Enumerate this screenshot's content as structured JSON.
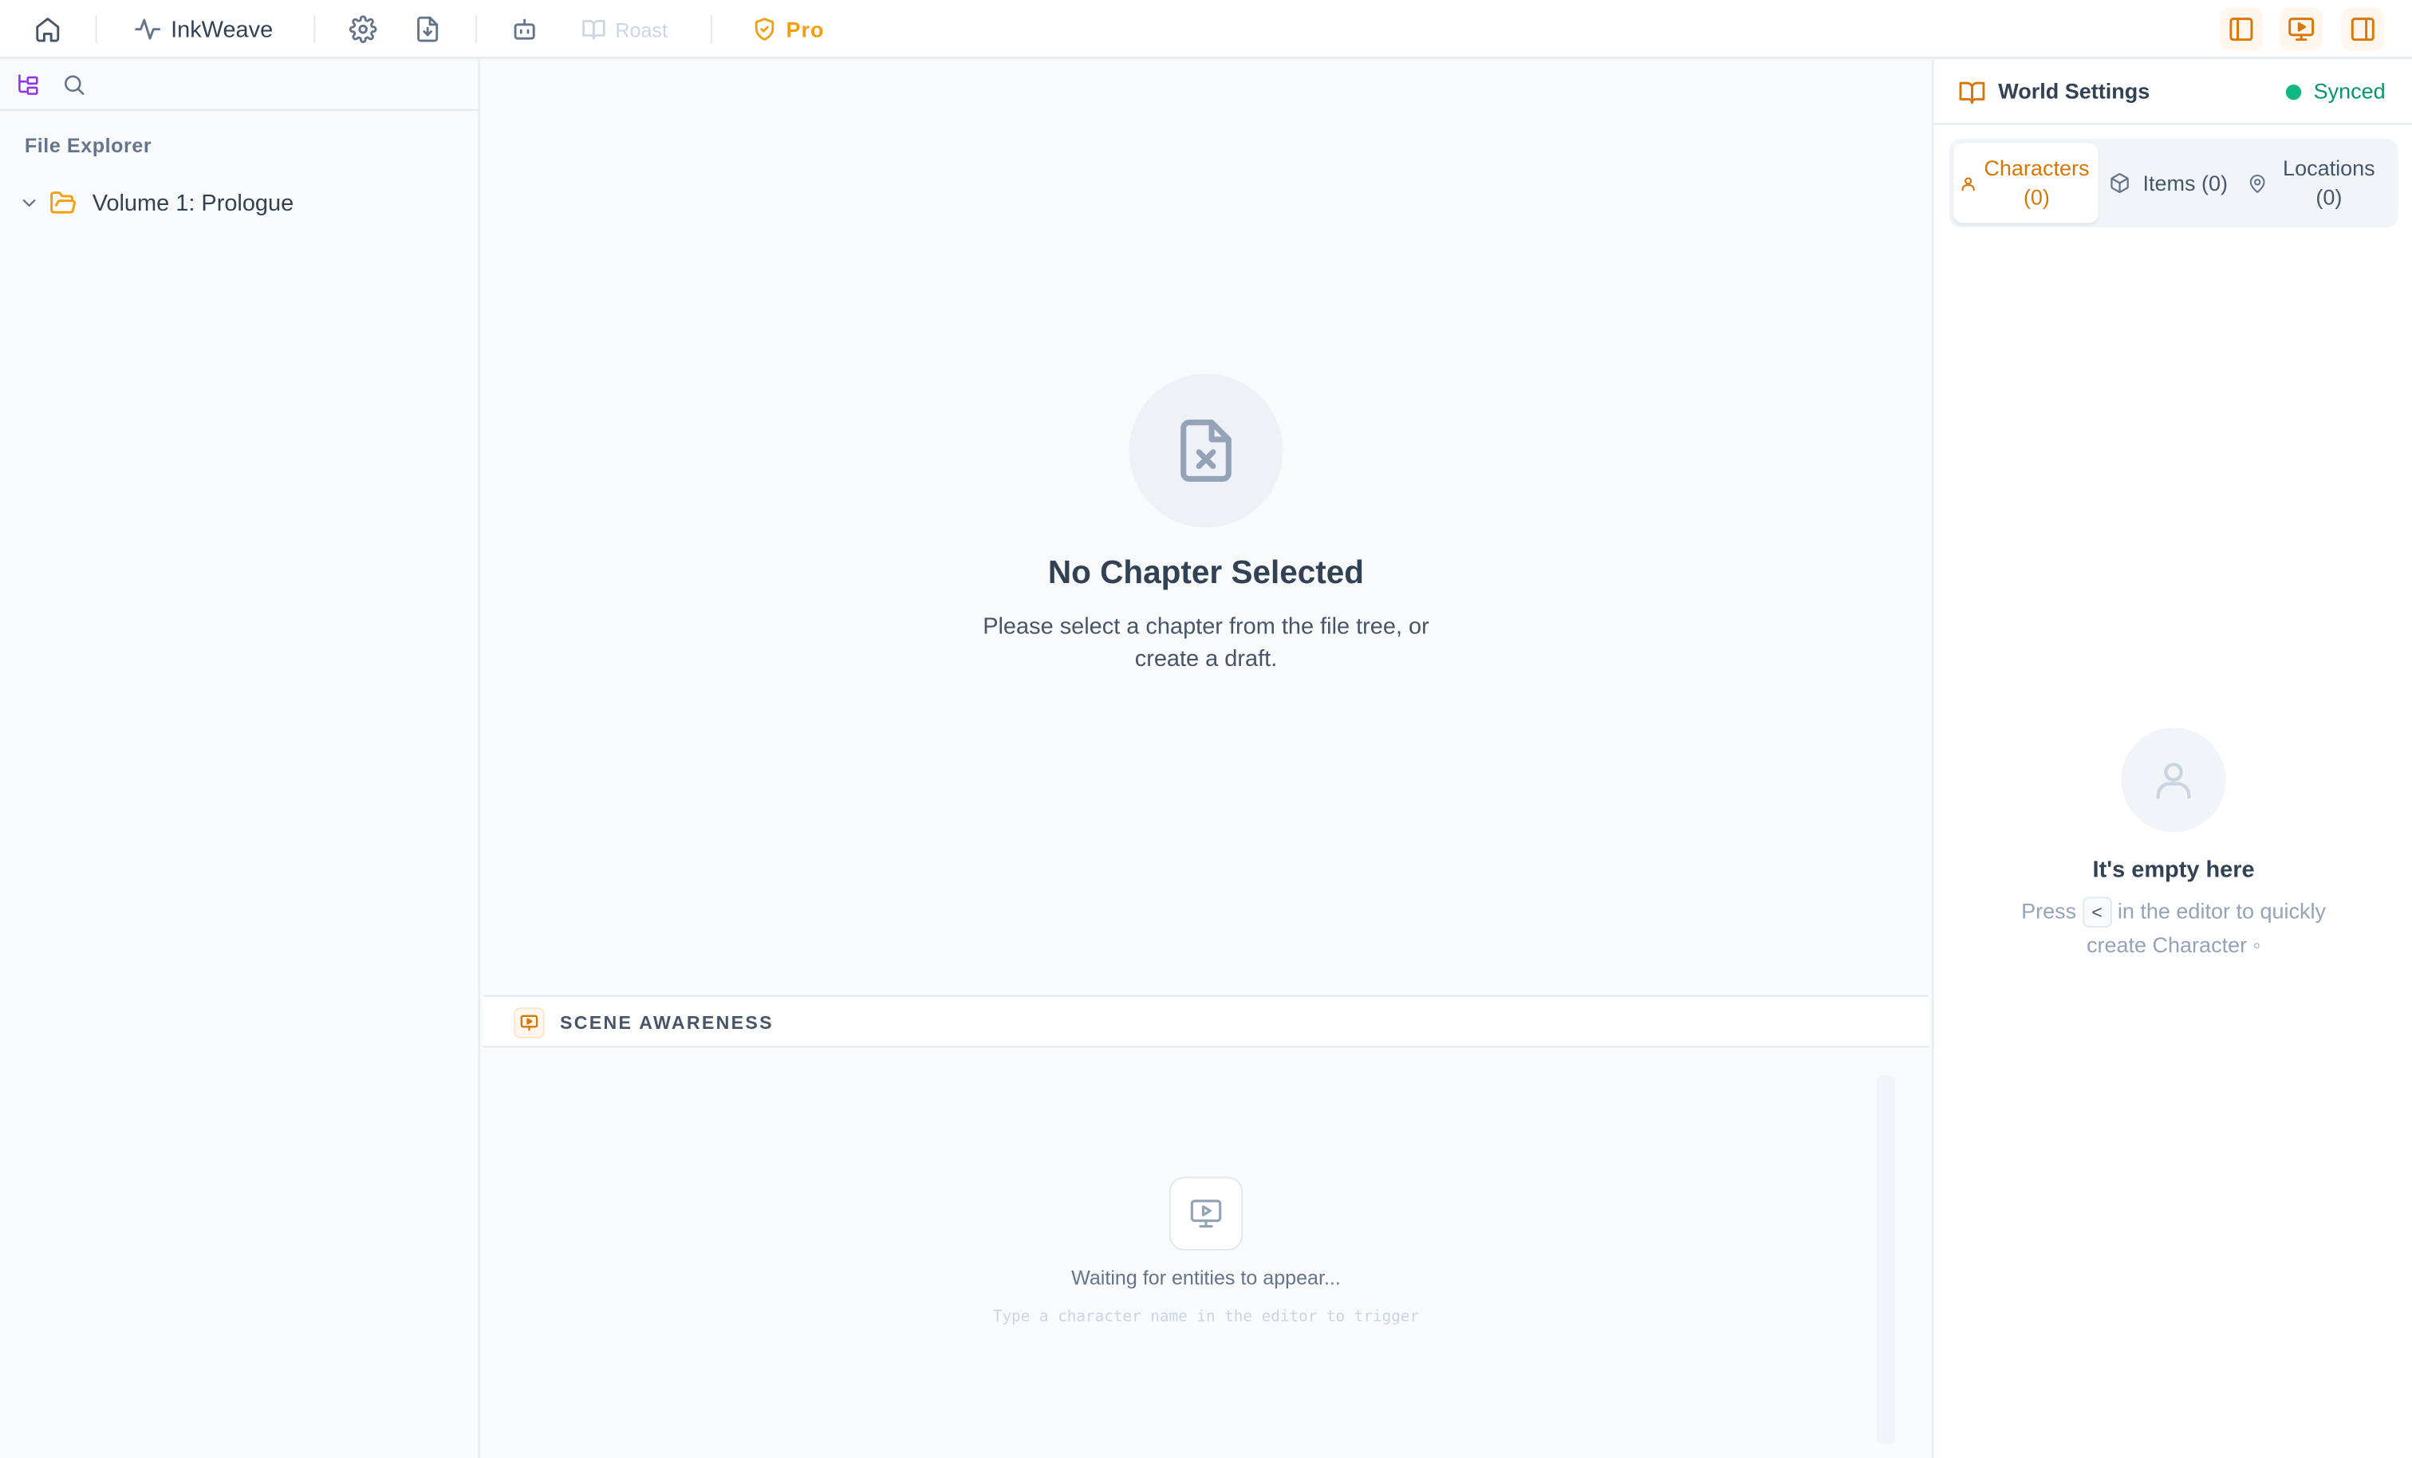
{
  "topbar": {
    "brand": "InkWeave",
    "roast": "Roast",
    "pro": "Pro",
    "accent": "#f59e0b"
  },
  "sidebar": {
    "title": "File Explorer",
    "tree": [
      {
        "label": "Volume 1: Prologue",
        "icon": "folder-open-icon",
        "expanded": true
      }
    ]
  },
  "main": {
    "empty": {
      "title": "No Chapter Selected",
      "description": "Please select a chapter from the file tree, or create a draft."
    },
    "scene": {
      "title": "SCENE AWARENESS",
      "waiting": "Waiting for entities to appear...",
      "hint": "Type a character name in the editor to trigger"
    }
  },
  "rightPanel": {
    "title": "World Settings",
    "sync_status": "Synced",
    "tabs": [
      {
        "label": "Characters (0)",
        "icon": "user-icon",
        "active": true
      },
      {
        "label": "Items (0)",
        "icon": "box-icon",
        "active": false
      },
      {
        "label": "Locations (0)",
        "icon": "map-pin-icon",
        "active": false
      }
    ],
    "empty": {
      "title": "It's empty here",
      "desc_pre": "Press",
      "key": "<",
      "desc_post": "in the editor to quickly create Character ◦"
    }
  }
}
